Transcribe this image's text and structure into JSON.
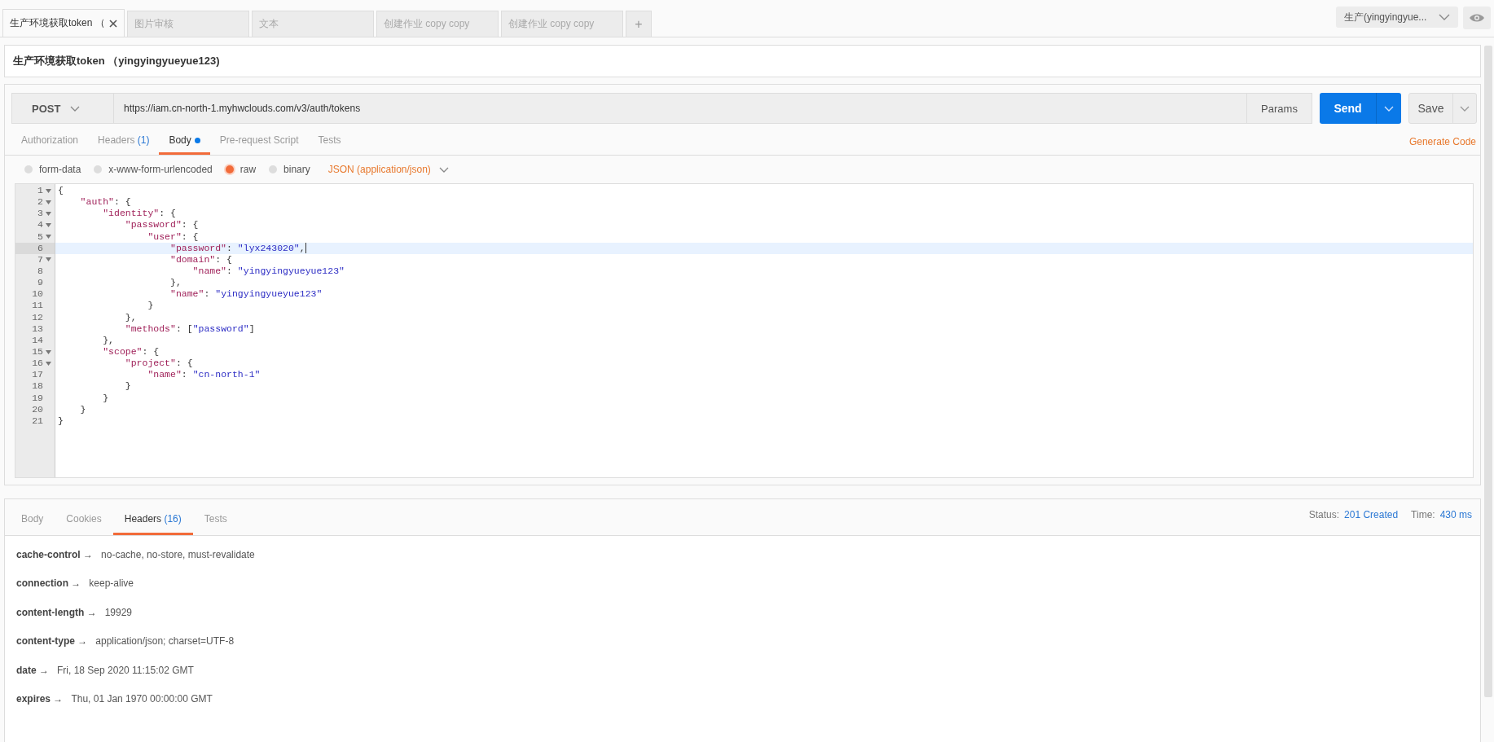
{
  "tabs": [
    {
      "label": "生产环境获取token （",
      "selected": true,
      "closable": true
    },
    {
      "label": "图片审核",
      "selected": false,
      "closable": false
    },
    {
      "label": "文本",
      "selected": false,
      "closable": false
    },
    {
      "label": "创建作业 copy copy",
      "selected": false,
      "closable": false
    },
    {
      "label": "创建作业 copy copy",
      "selected": false,
      "closable": false
    }
  ],
  "new_tab": "+",
  "environment": {
    "value": "生产(yingyingyue..."
  },
  "request_name": "生产环境获取token （yingyingyueyue123)",
  "request": {
    "method": "POST",
    "url": "https://iam.cn-north-1.myhwclouds.com/v3/auth/tokens",
    "params": "Params",
    "send": "Send",
    "save": "Save"
  },
  "request_tabs": [
    {
      "label": "Authorization",
      "selected": false,
      "modified": false
    },
    {
      "label": "Headers",
      "count": "(1)",
      "selected": false,
      "modified": false
    },
    {
      "label": "Body",
      "selected": true,
      "modified": true
    },
    {
      "label": "Pre-request Script",
      "selected": false,
      "modified": false
    },
    {
      "label": "Tests",
      "selected": false,
      "modified": false
    }
  ],
  "generate_code": "Generate Code",
  "body_modes": [
    {
      "label": "form-data",
      "selected": false
    },
    {
      "label": "x-www-form-urlencoded",
      "selected": false
    },
    {
      "label": "raw",
      "selected": true
    },
    {
      "label": "binary",
      "selected": false
    }
  ],
  "content_type": "JSON (application/json)",
  "editor": {
    "lines": [
      {
        "number": "1",
        "fold": true,
        "active": false,
        "tokens": [
          {
            "kind": "punct",
            "text": "{"
          }
        ],
        "children": [
          {
            "number": "2",
            "fold": true,
            "active": false,
            "tokens": [
              {
                "kind": "key",
                "text": "\"auth\""
              },
              {
                "kind": "punct",
                "text": ": {"
              }
            ],
            "children": [
              {
                "number": "3",
                "fold": true,
                "active": false,
                "tokens": [
                  {
                    "kind": "key",
                    "text": "\"identity\""
                  },
                  {
                    "kind": "punct",
                    "text": ": {"
                  }
                ],
                "children": [
                  {
                    "number": "4",
                    "fold": true,
                    "active": false,
                    "tokens": [
                      {
                        "kind": "key",
                        "text": "\"password\""
                      },
                      {
                        "kind": "punct",
                        "text": ": {"
                      }
                    ],
                    "children": [
                      {
                        "number": "5",
                        "fold": true,
                        "active": false,
                        "tokens": [
                          {
                            "kind": "key",
                            "text": "\"user\""
                          },
                          {
                            "kind": "punct",
                            "text": ": {"
                          }
                        ],
                        "children": [
                          {
                            "number": "6",
                            "fold": false,
                            "active": true,
                            "tokens": [
                              {
                                "kind": "key",
                                "text": "\"password\""
                              },
                              {
                                "kind": "punct",
                                "text": ": "
                              },
                              {
                                "kind": "string",
                                "text": "\"lyx243020\""
                              },
                              {
                                "kind": "punct",
                                "text": ","
                              }
                            ]
                          },
                          {
                            "number": "7",
                            "fold": true,
                            "active": false,
                            "tokens": [
                              {
                                "kind": "key",
                                "text": "\"domain\""
                              },
                              {
                                "kind": "punct",
                                "text": ": {"
                              }
                            ],
                            "children": [
                              {
                                "number": "8",
                                "fold": false,
                                "active": false,
                                "tokens": [
                                  {
                                    "kind": "key",
                                    "text": "\"name\""
                                  },
                                  {
                                    "kind": "punct",
                                    "text": ": "
                                  },
                                  {
                                    "kind": "string",
                                    "text": "\"yingyingyueyue123\""
                                  }
                                ]
                              }
                            ]
                          },
                          {
                            "number": "9",
                            "fold": false,
                            "active": false,
                            "tokens": [
                              {
                                "kind": "punct",
                                "text": "},"
                              }
                            ]
                          },
                          {
                            "number": "10",
                            "fold": false,
                            "active": false,
                            "tokens": [
                              {
                                "kind": "key",
                                "text": "\"name\""
                              },
                              {
                                "kind": "punct",
                                "text": ": "
                              },
                              {
                                "kind": "string",
                                "text": "\"yingyingyueyue123\""
                              }
                            ]
                          }
                        ]
                      },
                      {
                        "number": "11",
                        "fold": false,
                        "active": false,
                        "tokens": [
                          {
                            "kind": "punct",
                            "text": "}"
                          }
                        ]
                      }
                    ]
                  },
                  {
                    "number": "12",
                    "fold": false,
                    "active": false,
                    "tokens": [
                      {
                        "kind": "punct",
                        "text": "},"
                      }
                    ]
                  },
                  {
                    "number": "13",
                    "fold": false,
                    "active": false,
                    "tokens": [
                      {
                        "kind": "key",
                        "text": "\"methods\""
                      },
                      {
                        "kind": "punct",
                        "text": ": ["
                      },
                      {
                        "kind": "string",
                        "text": "\"password\""
                      },
                      {
                        "kind": "punct",
                        "text": "]"
                      }
                    ]
                  }
                ]
              },
              {
                "number": "14",
                "fold": false,
                "active": false,
                "tokens": [
                  {
                    "kind": "punct",
                    "text": "},"
                  }
                ]
              },
              {
                "number": "15",
                "fold": true,
                "active": false,
                "tokens": [
                  {
                    "kind": "key",
                    "text": "\"scope\""
                  },
                  {
                    "kind": "punct",
                    "text": ": {"
                  }
                ],
                "children": [
                  {
                    "number": "16",
                    "fold": true,
                    "active": false,
                    "tokens": [
                      {
                        "kind": "key",
                        "text": "\"project\""
                      },
                      {
                        "kind": "punct",
                        "text": ": {"
                      }
                    ],
                    "children": [
                      {
                        "number": "17",
                        "fold": false,
                        "active": false,
                        "tokens": [
                          {
                            "kind": "key",
                            "text": "\"name\""
                          },
                          {
                            "kind": "punct",
                            "text": ": "
                          },
                          {
                            "kind": "string",
                            "text": "\"cn-north-1\""
                          }
                        ]
                      }
                    ]
                  },
                  {
                    "number": "18",
                    "fold": false,
                    "active": false,
                    "tokens": [
                      {
                        "kind": "punct",
                        "text": "}"
                      }
                    ]
                  }
                ]
              },
              {
                "number": "19",
                "fold": false,
                "active": false,
                "tokens": [
                  {
                    "kind": "punct",
                    "text": "}"
                  }
                ]
              }
            ]
          },
          {
            "number": "20",
            "fold": false,
            "active": false,
            "tokens": [
              {
                "kind": "punct",
                "text": "}"
              }
            ]
          }
        ]
      },
      {
        "number": "21",
        "fold": false,
        "active": false,
        "tokens": [
          {
            "kind": "punct",
            "text": "}"
          }
        ]
      }
    ]
  },
  "response": {
    "tabs": [
      {
        "label": "Body",
        "selected": false
      },
      {
        "label": "Cookies",
        "selected": false
      },
      {
        "label": "Headers",
        "count": "(16)",
        "selected": true
      },
      {
        "label": "Tests",
        "selected": false
      }
    ],
    "status_label": "Status:",
    "status": "201 Created",
    "time_label": "Time:",
    "time": "430 ms",
    "headers": [
      {
        "name": "cache-control →",
        "value": "no-cache, no-store, must-revalidate"
      },
      {
        "name": "connection →",
        "value": "keep-alive"
      },
      {
        "name": "content-length →",
        "value": "19929"
      },
      {
        "name": "content-type →",
        "value": "application/json; charset=UTF-8"
      },
      {
        "name": "date →",
        "value": "Fri, 18 Sep 2020 11:15:02 GMT"
      },
      {
        "name": "expires →",
        "value": "Thu, 01 Jan 1970 00:00:00 GMT"
      }
    ]
  }
}
